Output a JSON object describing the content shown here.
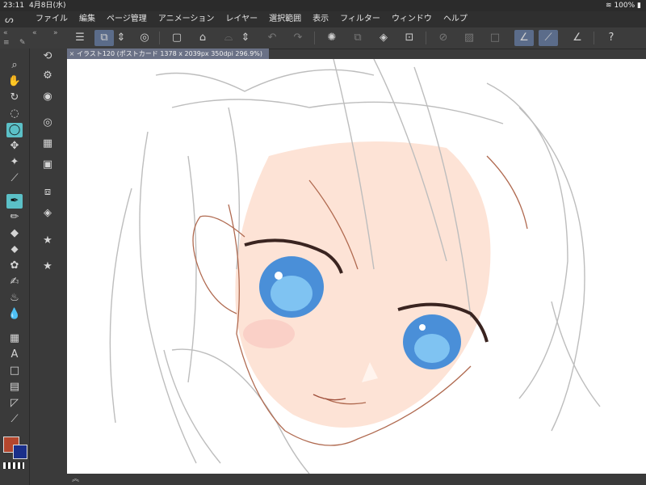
{
  "status": {
    "time": "23:11",
    "date": "4月8日(水)",
    "battery": "100%"
  },
  "menu": {
    "items": [
      "ファイル",
      "編集",
      "ページ管理",
      "アニメーション",
      "レイヤー",
      "選択範囲",
      "表示",
      "フィルター",
      "ウィンドウ",
      "ヘルプ"
    ]
  },
  "doc": {
    "tab_title": "イラスト120 (ポストカード 1378 x 2039px 350dpi 296.9%)"
  },
  "colors": {
    "main": "#b3462d",
    "sub": "#1a2f8a",
    "accent": "#5bc0c7"
  },
  "icons": {
    "toolbar": [
      "menu-icon",
      "canvas-icon",
      "updown-icon",
      "spiral-icon",
      "new-icon",
      "folder-icon",
      "save-icon",
      "updown-icon",
      "undo-icon",
      "redo-icon",
      "loading-icon",
      "copy-icon",
      "fill-icon",
      "transform-icon",
      "hide-icon",
      "erase-icon",
      "square-icon",
      "snap-icon",
      "ruler-icon",
      "pen-icon",
      "help-icon"
    ],
    "tools": [
      "zoom-icon",
      "hand-icon",
      "rotate-icon",
      "lasso-icon",
      "select-icon",
      "move-icon",
      "wand-icon",
      "eyedropper-icon",
      "pen-icon",
      "pencil-icon",
      "eraser-icon",
      "fill-icon",
      "blend-icon",
      "brush-icon",
      "airbrush-icon",
      "water-icon",
      "gradient-icon",
      "text-icon",
      "frame-icon",
      "panel-icon",
      "ruler-icon",
      "line-icon"
    ]
  }
}
